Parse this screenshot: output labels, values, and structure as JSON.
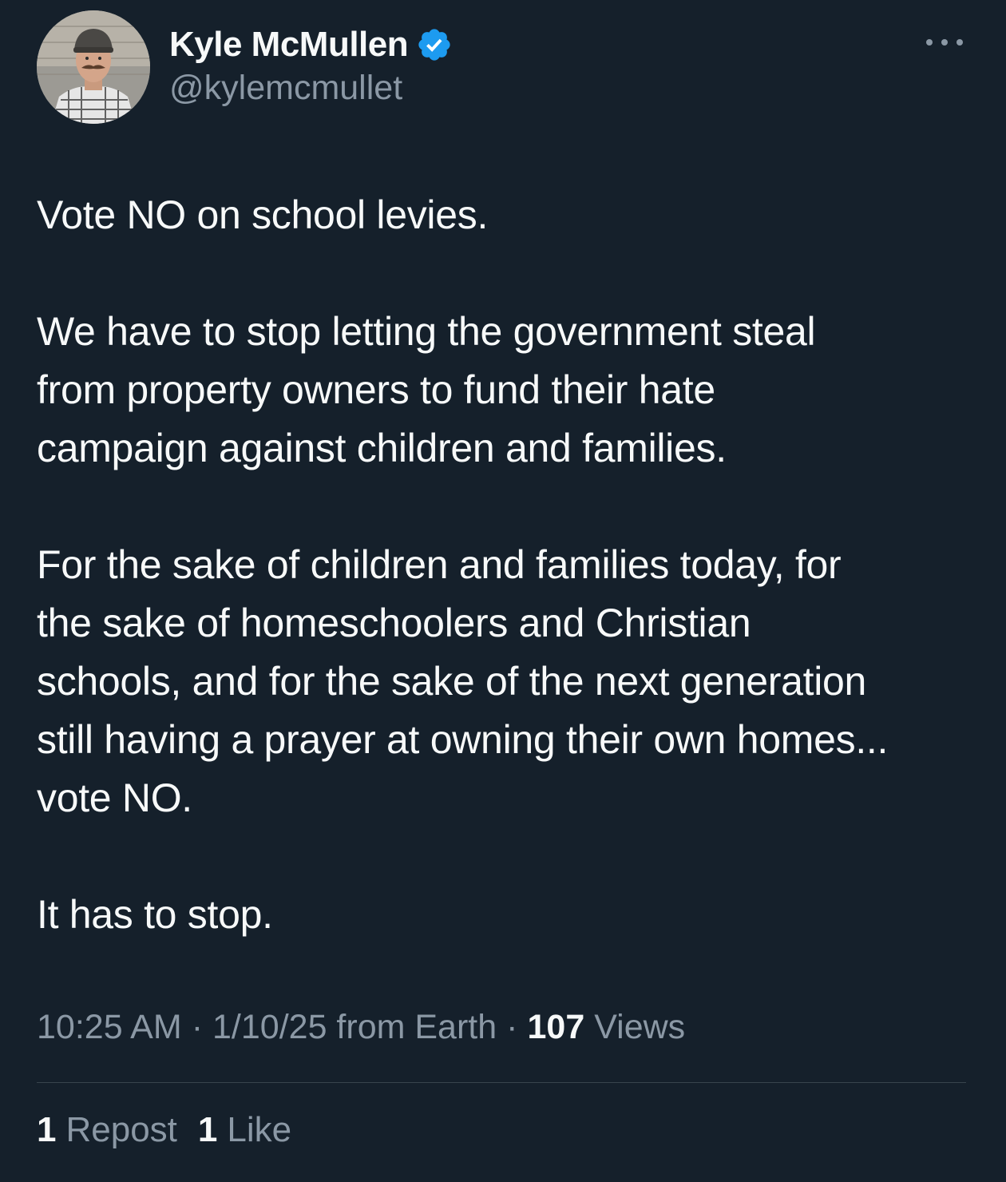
{
  "author": {
    "display_name": "Kyle McMullen",
    "handle": "@kylemcmullet",
    "verified_icon": "verified-badge-icon",
    "verified_color": "#1d9bf0",
    "avatar_icon": "profile-photo"
  },
  "more_icon": "more-options-icon",
  "tweet": {
    "paragraphs": [
      "Vote NO on school levies.",
      "We have to stop letting the government steal\nfrom property owners to fund their hate\ncampaign against children and families.",
      "For the sake of children and families today, for\nthe sake of homeschoolers and Christian\nschools, and for the sake of the next generation\nstill having a prayer at owning their own homes...\nvote NO.",
      "It has to stop."
    ]
  },
  "meta": {
    "time": "10:25 AM",
    "separator": "·",
    "date_source": "1/10/25 from Earth",
    "views_count": "107",
    "views_label": "Views"
  },
  "stats": {
    "reposts_count": "1",
    "reposts_label": "Repost",
    "likes_count": "1",
    "likes_label": "Like"
  },
  "colors": {
    "background": "#15202b",
    "primary_text": "#f7f9f9",
    "secondary_text": "#8b98a5",
    "divider": "#38444d",
    "accent": "#1d9bf0"
  }
}
